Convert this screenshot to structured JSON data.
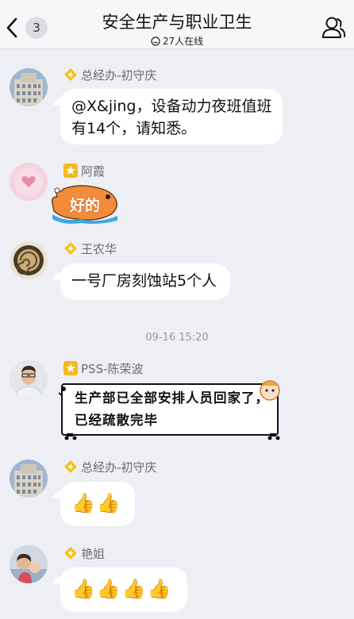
{
  "header": {
    "back_badge": "3",
    "title": "安全生产与职业卫生",
    "online_text": "27人在线"
  },
  "messages": [
    {
      "sender": "总经办-初守庆",
      "text": "@X&jing，设备动力夜班值班有14个，请知悉。",
      "line1": "@X&jing，设备动力夜班值班",
      "line2": "有14个，请知悉。"
    },
    {
      "sender": "阿霞",
      "sticker_text": "好的"
    },
    {
      "sender": "王农华",
      "text": "一号厂房刻蚀站5个人"
    },
    {
      "sender": "PSS-陈荣波",
      "line1": "生产部已全部安排人员回家了，",
      "line2": "已经疏散完毕"
    },
    {
      "sender": "总经办-初守庆",
      "text": "👍👍"
    },
    {
      "sender": "艳姐",
      "text": "👍👍👍👍"
    }
  ],
  "time_separator": "09-16 15:20",
  "colors": {
    "background": "#eeeff4",
    "bubble": "#ffffff",
    "badge_gold": "#f5c21b"
  }
}
